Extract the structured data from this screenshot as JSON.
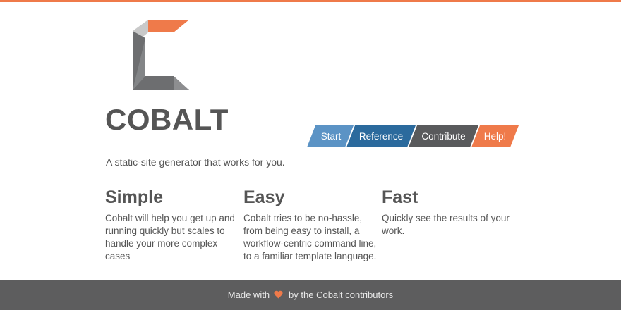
{
  "header": {
    "title": "COBALT",
    "tagline": "A static-site generator that works for you."
  },
  "nav": {
    "items": [
      {
        "label": "Start",
        "color": "#5b93c5"
      },
      {
        "label": "Reference",
        "color": "#2b6a9d"
      },
      {
        "label": "Contribute",
        "color": "#595a5c"
      },
      {
        "label": "Help!",
        "color": "#ef7a4a"
      }
    ]
  },
  "features": [
    {
      "heading": "Simple",
      "text": "Cobalt will help you get up and running quickly but scales to handle your more complex cases"
    },
    {
      "heading": "Easy",
      "text": "Cobalt tries to be no-hassle, from being easy to install, a workflow-centric command line, to a familiar template language."
    },
    {
      "heading": "Fast",
      "text": "Quickly see the results of your work."
    }
  ],
  "footer": {
    "before": "Made with",
    "icon": "heart-icon",
    "after": "by the Cobalt contributors"
  },
  "colors": {
    "accent": "#ef7a4a",
    "footer_bg": "#5d5d5e"
  }
}
